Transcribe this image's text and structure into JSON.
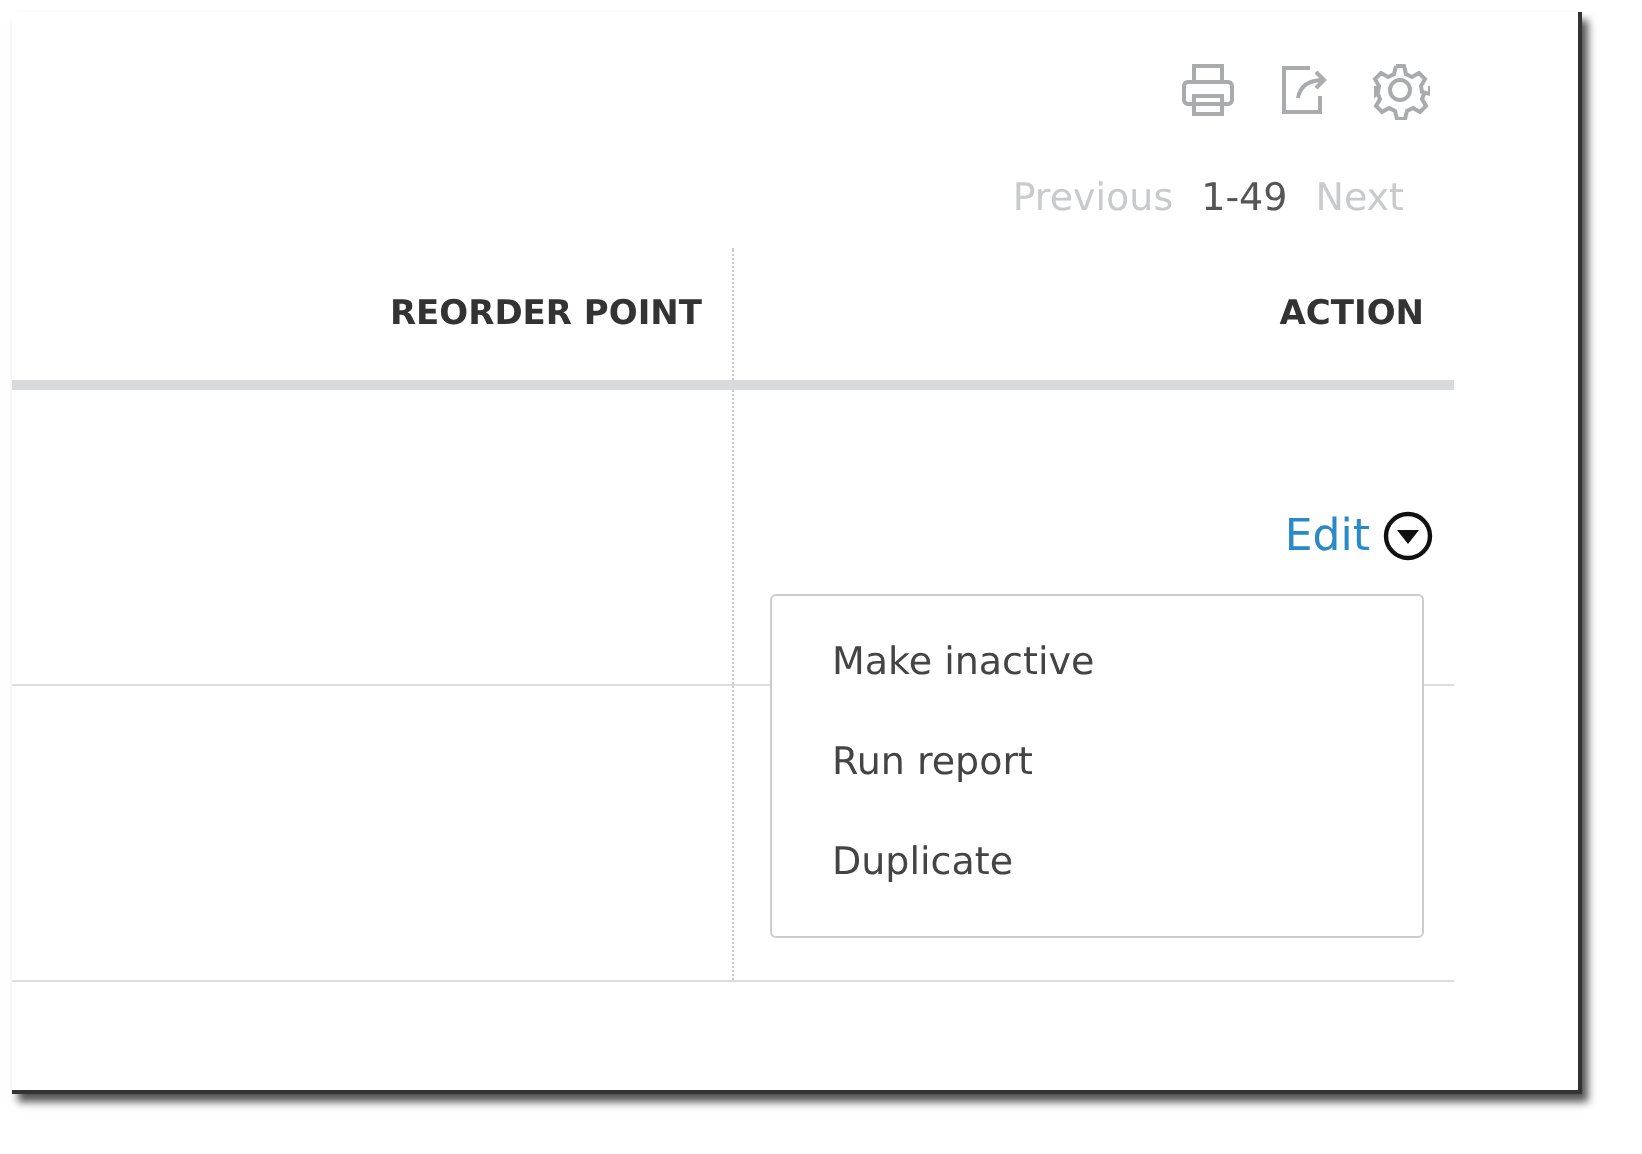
{
  "pager": {
    "previous": {
      "label": "Previous",
      "disabled": true
    },
    "range": "1-49",
    "next": {
      "label": "Next",
      "disabled": true
    }
  },
  "table": {
    "columns": [
      "REORDER POINT",
      "ACTION"
    ],
    "rows": [
      {
        "action": "Edit",
        "menu_open": true
      },
      {
        "action": null,
        "menu_open": false
      }
    ]
  },
  "menu": {
    "items": [
      {
        "label": "Make inactive"
      },
      {
        "label": "Run report"
      },
      {
        "label": "Duplicate"
      }
    ]
  }
}
